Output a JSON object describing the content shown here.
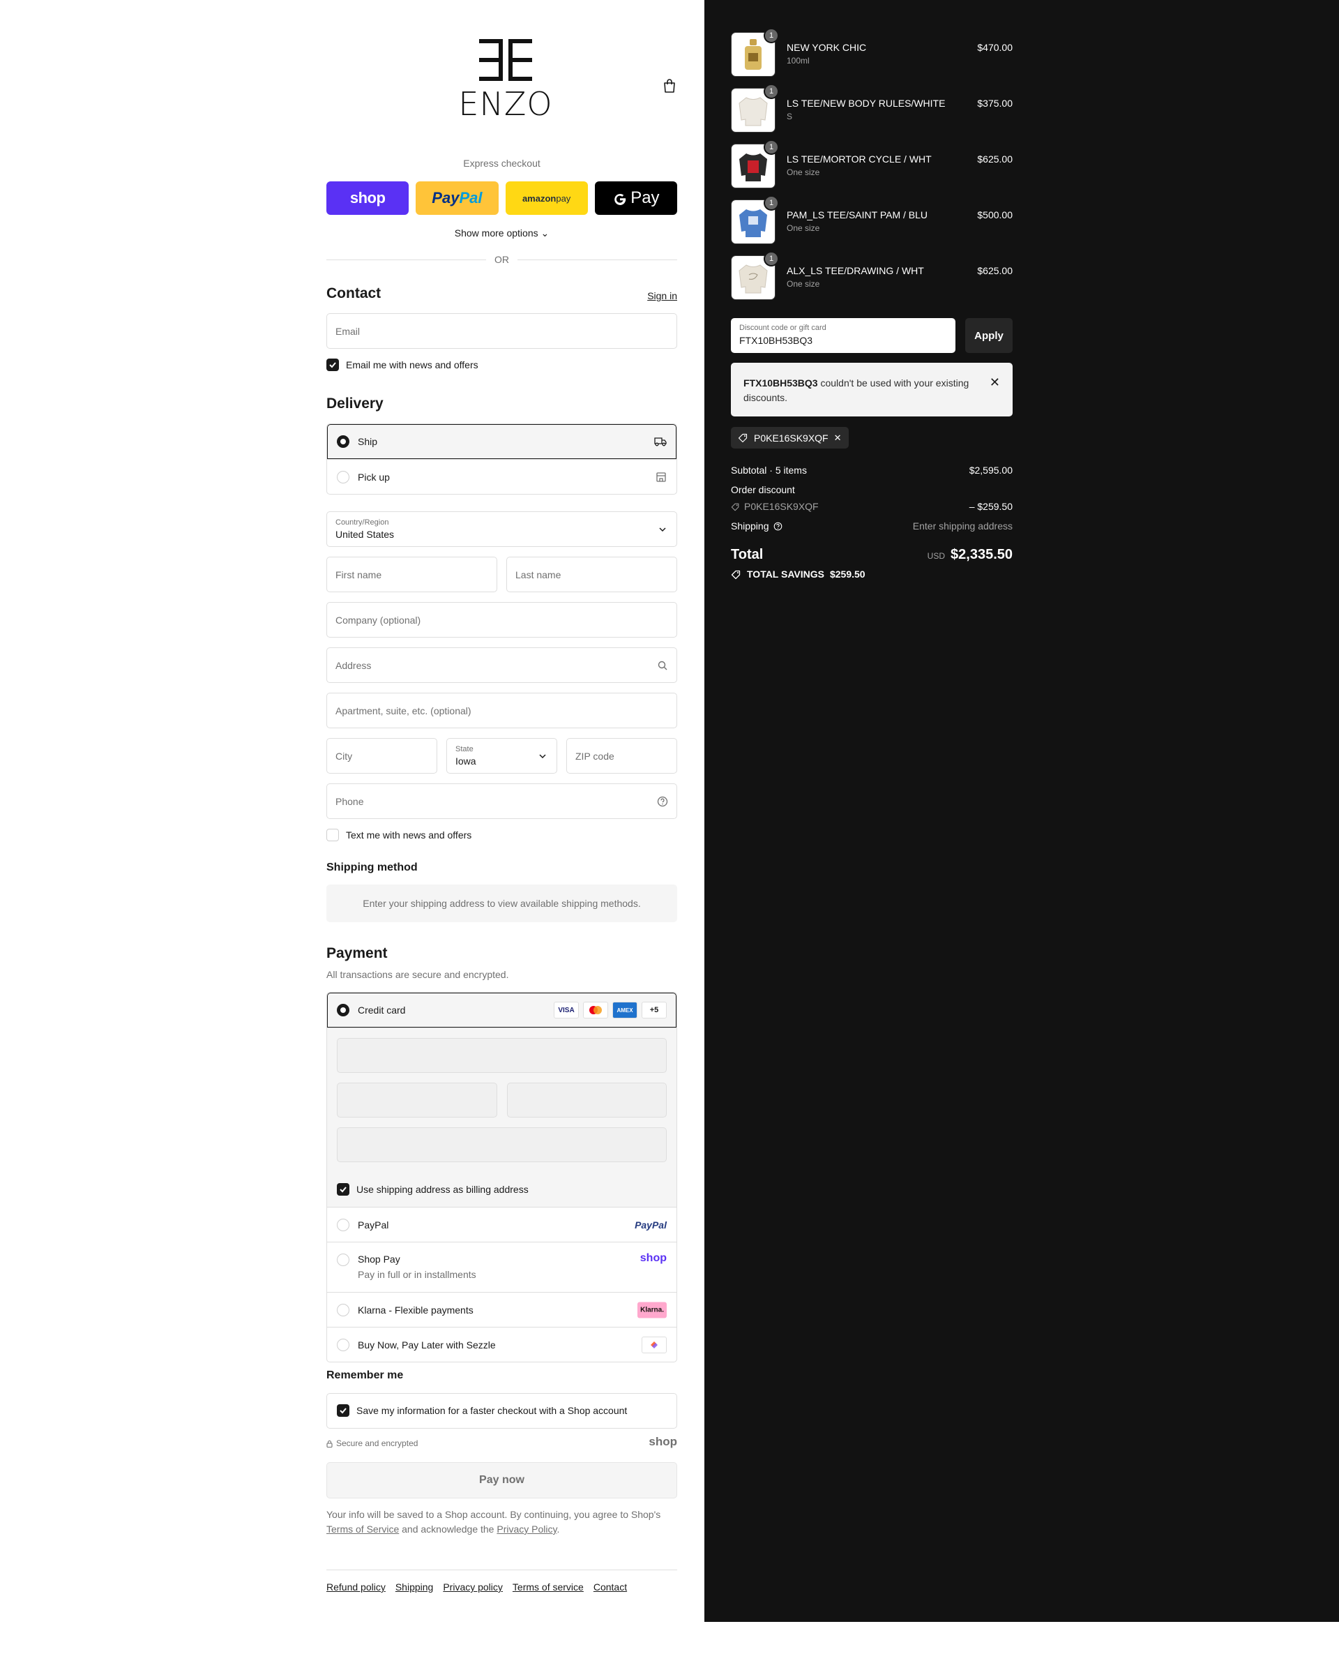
{
  "brand": {
    "logo_text": "ENZO"
  },
  "express": {
    "label": "Express checkout",
    "shop": "shop",
    "paypal_a": "Pay",
    "paypal_b": "Pal",
    "amazon_a": "amazon",
    "amazon_b": " pay",
    "gpay": "Pay",
    "show_more": "Show more options",
    "or": "OR"
  },
  "contact": {
    "title": "Contact",
    "sign_in": "Sign in",
    "email_placeholder": "Email",
    "news_label": "Email me with news and offers"
  },
  "delivery": {
    "title": "Delivery",
    "options": [
      {
        "label": "Ship",
        "selected": true
      },
      {
        "label": "Pick up",
        "selected": false
      }
    ],
    "country_label": "Country/Region",
    "country_value": "United States",
    "first_name": "First name",
    "last_name": "Last name",
    "company": "Company (optional)",
    "address": "Address",
    "apartment": "Apartment, suite, etc. (optional)",
    "city": "City",
    "state_label": "State",
    "state_value": "Iowa",
    "zip": "ZIP code",
    "phone": "Phone",
    "text_news": "Text me with news and offers"
  },
  "shipping_method": {
    "title": "Shipping method",
    "note": "Enter your shipping address to view available shipping methods."
  },
  "payment": {
    "title": "Payment",
    "subtitle": "All transactions are secure and encrypted.",
    "credit_card": "Credit card",
    "card_brands": [
      "VISA",
      "",
      "AMEX",
      "+5"
    ],
    "billing_label": "Use shipping address as billing address",
    "paypal": "PayPal",
    "paypal_logo": "PayPal",
    "shop_pay": "Shop Pay",
    "shop_pay_sub": "Pay in full or in installments",
    "shop_logo": "shop",
    "klarna": "Klarna - Flexible payments",
    "klarna_logo": "Klarna.",
    "sezzle": "Buy Now, Pay Later with Sezzle"
  },
  "remember": {
    "title": "Remember me",
    "save_label": "Save my information for a faster checkout with a Shop account",
    "secure": "Secure and encrypted",
    "shop_logo": "shop"
  },
  "pay_now": "Pay now",
  "legal": {
    "a": "Your info will be saved to a Shop account. By continuing, you agree to Shop's ",
    "tos": "Terms of Service",
    "b": " and acknowledge the ",
    "privacy": "Privacy Policy",
    "c": "."
  },
  "footer": [
    "Refund policy",
    "Shipping",
    "Privacy policy",
    "Terms of service",
    "Contact"
  ],
  "cart": {
    "items": [
      {
        "name": "NEW YORK CHIC",
        "variant": "100ml",
        "price": "$470.00",
        "qty": "1"
      },
      {
        "name": "LS TEE/NEW BODY RULES/WHITE",
        "variant": "S",
        "price": "$375.00",
        "qty": "1"
      },
      {
        "name": "LS TEE/MORTOR CYCLE / WHT",
        "variant": "One size",
        "price": "$625.00",
        "qty": "1"
      },
      {
        "name": "PAM_LS TEE/SAINT PAM / BLU",
        "variant": "One size",
        "price": "$500.00",
        "qty": "1"
      },
      {
        "name": "ALX_LS TEE/DRAWING / WHT",
        "variant": "One size",
        "price": "$625.00",
        "qty": "1"
      }
    ],
    "discount_label": "Discount code or gift card",
    "discount_value": "FTX10BH53BQ3",
    "apply": "Apply",
    "error_code": "FTX10BH53BQ3",
    "error_text": " couldn't be used with your existing discounts.",
    "applied_code": "P0KE16SK9XQF",
    "subtotal_label": "Subtotal · 5 items",
    "subtotal": "$2,595.00",
    "order_discount": "Order discount",
    "discount_code_line": "P0KE16SK9XQF",
    "discount_amount": "– $259.50",
    "shipping_label": "Shipping",
    "shipping_value": "Enter shipping address",
    "total_label": "Total",
    "currency": "USD",
    "total": "$2,335.50",
    "savings_label": "TOTAL SAVINGS",
    "savings": "$259.50"
  }
}
